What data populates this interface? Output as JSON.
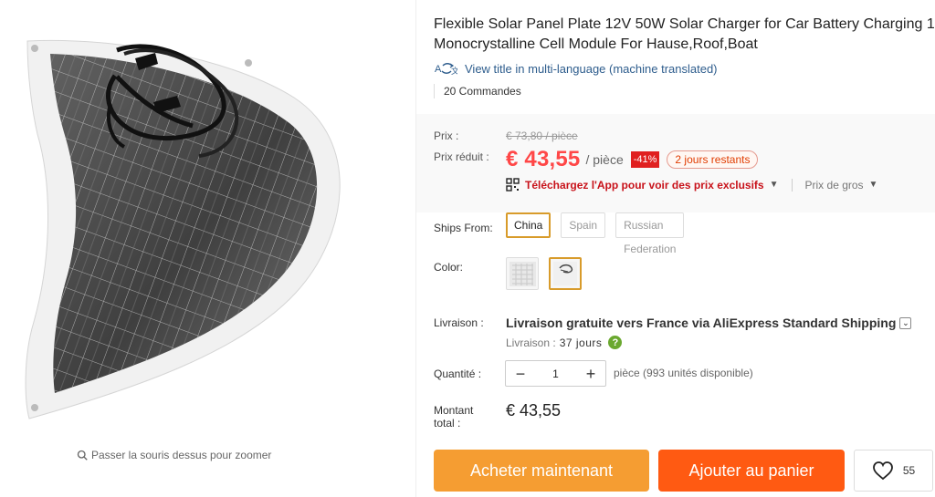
{
  "product": {
    "title": "Flexible Solar Panel Plate 12V 50W Solar Charger for Car Battery Charging 1",
    "title_line2": "Monocrystalline Cell Module For Hause,Roof,Boat",
    "translate_link": "View title in multi-language (machine translated)",
    "orders": "20 Commandes"
  },
  "gallery": {
    "zoom_hint": "Passer la souris dessus pour zoomer"
  },
  "price": {
    "old_label": "Prix :",
    "old_price": "€ 73,80 / pièce",
    "sale_label": "Prix réduit :",
    "sale_price": "€ 43,55",
    "unit": "/ pièce",
    "discount": "-41%",
    "days_left": "2 jours restants",
    "app_link": "Téléchargez l'App pour voir des prix exclusifs",
    "wholesale": "Prix de gros"
  },
  "ships_from": {
    "label": "Ships From:",
    "options": [
      "China",
      "Spain",
      "Russian Federation"
    ],
    "selected": "China"
  },
  "color": {
    "label": "Color:",
    "selected_index": 1
  },
  "delivery": {
    "label": "Livraison :",
    "method": "Livraison gratuite vers France via AliExpress Standard Shipping",
    "time_label": "Livraison :",
    "time_value": "37 jours"
  },
  "quantity": {
    "label": "Quantité :",
    "value": "1",
    "stock": "pièce (993 unités disponible)"
  },
  "total": {
    "label": "Montant total :",
    "value": "€ 43,55"
  },
  "actions": {
    "buy_now": "Acheter maintenant",
    "add_to_cart": "Ajouter au panier",
    "wishlist_count": "55"
  },
  "colors": {
    "price_red": "#ff4747",
    "buy_now_orange": "#f59d32",
    "add_cart_orange": "#ff5a12",
    "selection_gold": "#d89b2a"
  }
}
